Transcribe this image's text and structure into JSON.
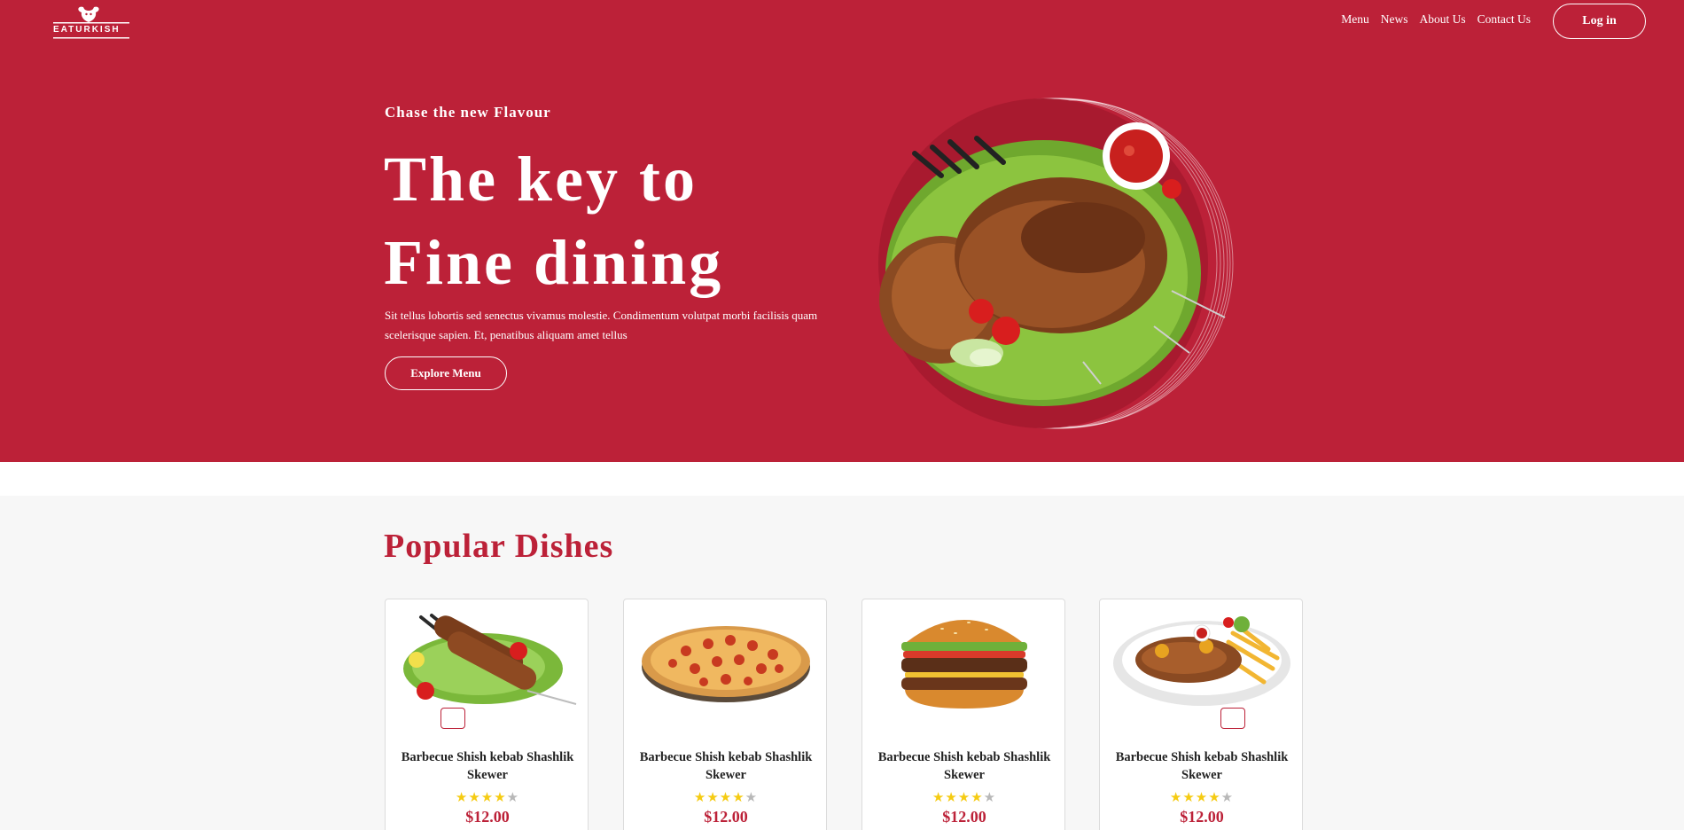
{
  "brand": {
    "name": "EATURKISH"
  },
  "nav": {
    "items": [
      "Menu",
      "News",
      "About Us",
      "Contact Us"
    ],
    "login": "Log in"
  },
  "hero": {
    "eyebrow": "Chase the new Flavour",
    "headline_line1": "The key to",
    "headline_line2": "Fine dining",
    "description": "Sit tellus lobortis sed senectus vivamus molestie. Condimentum volutpat morbi facilisis quam scelerisque sapien. Et, penatibus aliquam amet tellus",
    "cta": "Explore Menu"
  },
  "popular": {
    "title": "Popular Dishes",
    "dishes": [
      {
        "name": "Barbecue Shish kebab Shashlik Skewer",
        "rating": 4,
        "max_rating": 5,
        "price": "$12.00",
        "image": "kebab-skewers"
      },
      {
        "name": "Barbecue Shish kebab Shashlik Skewer",
        "rating": 4,
        "max_rating": 5,
        "price": "$12.00",
        "image": "pepperoni-pizza"
      },
      {
        "name": "Barbecue Shish kebab Shashlik Skewer",
        "rating": 4,
        "max_rating": 5,
        "price": "$12.00",
        "image": "burger"
      },
      {
        "name": "Barbecue Shish kebab Shashlik Skewer",
        "rating": 4,
        "max_rating": 5,
        "price": "$12.00",
        "image": "kebab-plate-fries"
      }
    ]
  },
  "colors": {
    "brand_red": "#bc2138",
    "star": "#f5cb12",
    "star_off": "#b8b8b8",
    "background": "#f7f7f7"
  }
}
